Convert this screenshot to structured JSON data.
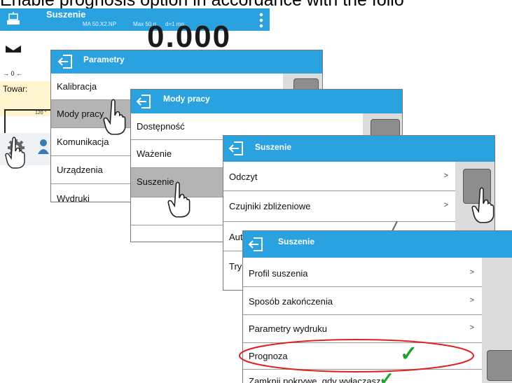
{
  "caption": "Enable prognosis option in accordance with the follo",
  "base_screen": {
    "title": "Suszenie",
    "model": "MA 50.X2.NP",
    "max": "Max 50 g",
    "d": "d=1 mg",
    "big_value": "0.000",
    "zero_sym": "→ 0 ←",
    "towar_label": "Towar:",
    "small_value": "120 °"
  },
  "parametry": {
    "title": "Parametry",
    "items": [
      "Kalibracja",
      "Mody pracy",
      "Komunikacja",
      "Urządzenia",
      "Wydruki"
    ]
  },
  "mody_pracy": {
    "title": "Mody pracy",
    "items": [
      "Dostępność",
      "Ważenie",
      "Suszenie"
    ]
  },
  "suszenie1": {
    "title": "Suszenie",
    "items": [
      {
        "label": "Odczyt",
        "arrow": ">"
      },
      {
        "label": "Czujniki zbliżeniowe",
        "arrow": ">"
      },
      {
        "label": "Auto",
        "arrow": ""
      },
      {
        "label": "Tryb",
        "arrow": ""
      }
    ]
  },
  "suszenie2": {
    "title": "Suszenie",
    "items": [
      {
        "label": "Profil suszenia",
        "arrow": ">"
      },
      {
        "label": "Sposób zakończenia",
        "arrow": ">"
      },
      {
        "label": "Parametry wydruku",
        "arrow": ">"
      },
      {
        "label": "Prognoza",
        "arrow": ""
      },
      {
        "label": "Zamknij pokrywe, gdy wyłączasz",
        "arrow": ""
      }
    ]
  },
  "colors": {
    "header_blue": "#2aa2e0",
    "check_green": "#1ea32a",
    "highlight_red": "#e0211f"
  }
}
